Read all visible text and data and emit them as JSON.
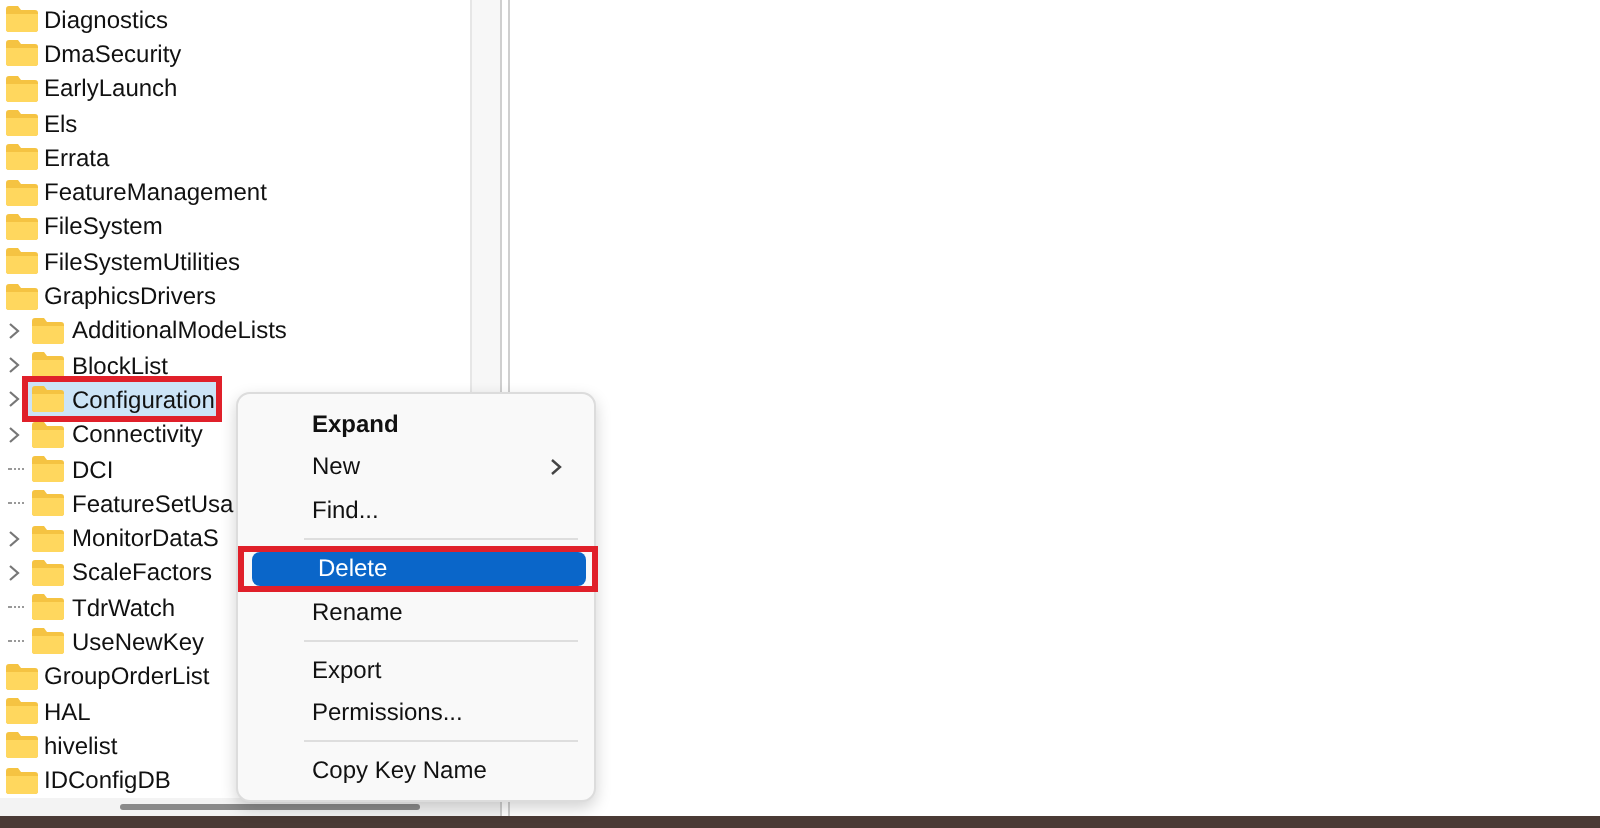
{
  "tree": [
    {
      "label": "Diagnostics",
      "selected": false
    },
    {
      "label": "DmaSecurity",
      "selected": false
    },
    {
      "label": "EarlyLaunch",
      "selected": false
    },
    {
      "label": "Els",
      "selected": false
    },
    {
      "label": "Errata",
      "selected": false
    },
    {
      "label": "FeatureManagement",
      "selected": false
    },
    {
      "label": "FileSystem",
      "selected": false
    },
    {
      "label": "FileSystemUtilities",
      "selected": false
    },
    {
      "label": "GraphicsDrivers",
      "selected": false,
      "children": [
        {
          "label": "AdditionalModeLists",
          "expandable": true,
          "selected": false,
          "highlighted": false
        },
        {
          "label": "BlockList",
          "expandable": true,
          "selected": false,
          "highlighted": false
        },
        {
          "label": "Configuration",
          "expandable": true,
          "selected": true,
          "highlighted": true
        },
        {
          "label": "Connectivity",
          "expandable": true,
          "selected": false,
          "highlighted": false
        },
        {
          "label": "DCI",
          "expandable": false,
          "selected": false,
          "highlighted": false
        },
        {
          "label": "FeatureSetUsa",
          "expandable": false,
          "selected": false,
          "highlighted": false
        },
        {
          "label": "MonitorDataS",
          "expandable": true,
          "selected": false,
          "highlighted": false
        },
        {
          "label": "ScaleFactors",
          "expandable": true,
          "selected": false,
          "highlighted": false
        },
        {
          "label": "TdrWatch",
          "expandable": false,
          "selected": false,
          "highlighted": false
        },
        {
          "label": "UseNewKey",
          "expandable": false,
          "selected": false,
          "highlighted": false
        }
      ]
    },
    {
      "label": "GroupOrderList",
      "selected": false
    },
    {
      "label": "HAL",
      "selected": false
    },
    {
      "label": "hivelist",
      "selected": false
    },
    {
      "label": "IDConfigDB",
      "selected": false
    }
  ],
  "context_menu": [
    {
      "kind": "item",
      "label": "Expand",
      "bold": true,
      "submenu": false,
      "selected": false,
      "highlighted": false
    },
    {
      "kind": "item",
      "label": "New",
      "bold": false,
      "submenu": true,
      "selected": false,
      "highlighted": false
    },
    {
      "kind": "item",
      "label": "Find...",
      "bold": false,
      "submenu": false,
      "selected": false,
      "highlighted": false
    },
    {
      "kind": "separator"
    },
    {
      "kind": "item",
      "label": "Delete",
      "bold": false,
      "submenu": false,
      "selected": true,
      "highlighted": true
    },
    {
      "kind": "item",
      "label": "Rename",
      "bold": false,
      "submenu": false,
      "selected": false,
      "highlighted": false
    },
    {
      "kind": "separator"
    },
    {
      "kind": "item",
      "label": "Export",
      "bold": false,
      "submenu": false,
      "selected": false,
      "highlighted": false
    },
    {
      "kind": "item",
      "label": "Permissions...",
      "bold": false,
      "submenu": false,
      "selected": false,
      "highlighted": false
    },
    {
      "kind": "separator"
    },
    {
      "kind": "item",
      "label": "Copy Key Name",
      "bold": false,
      "submenu": false,
      "selected": false,
      "highlighted": false
    }
  ]
}
